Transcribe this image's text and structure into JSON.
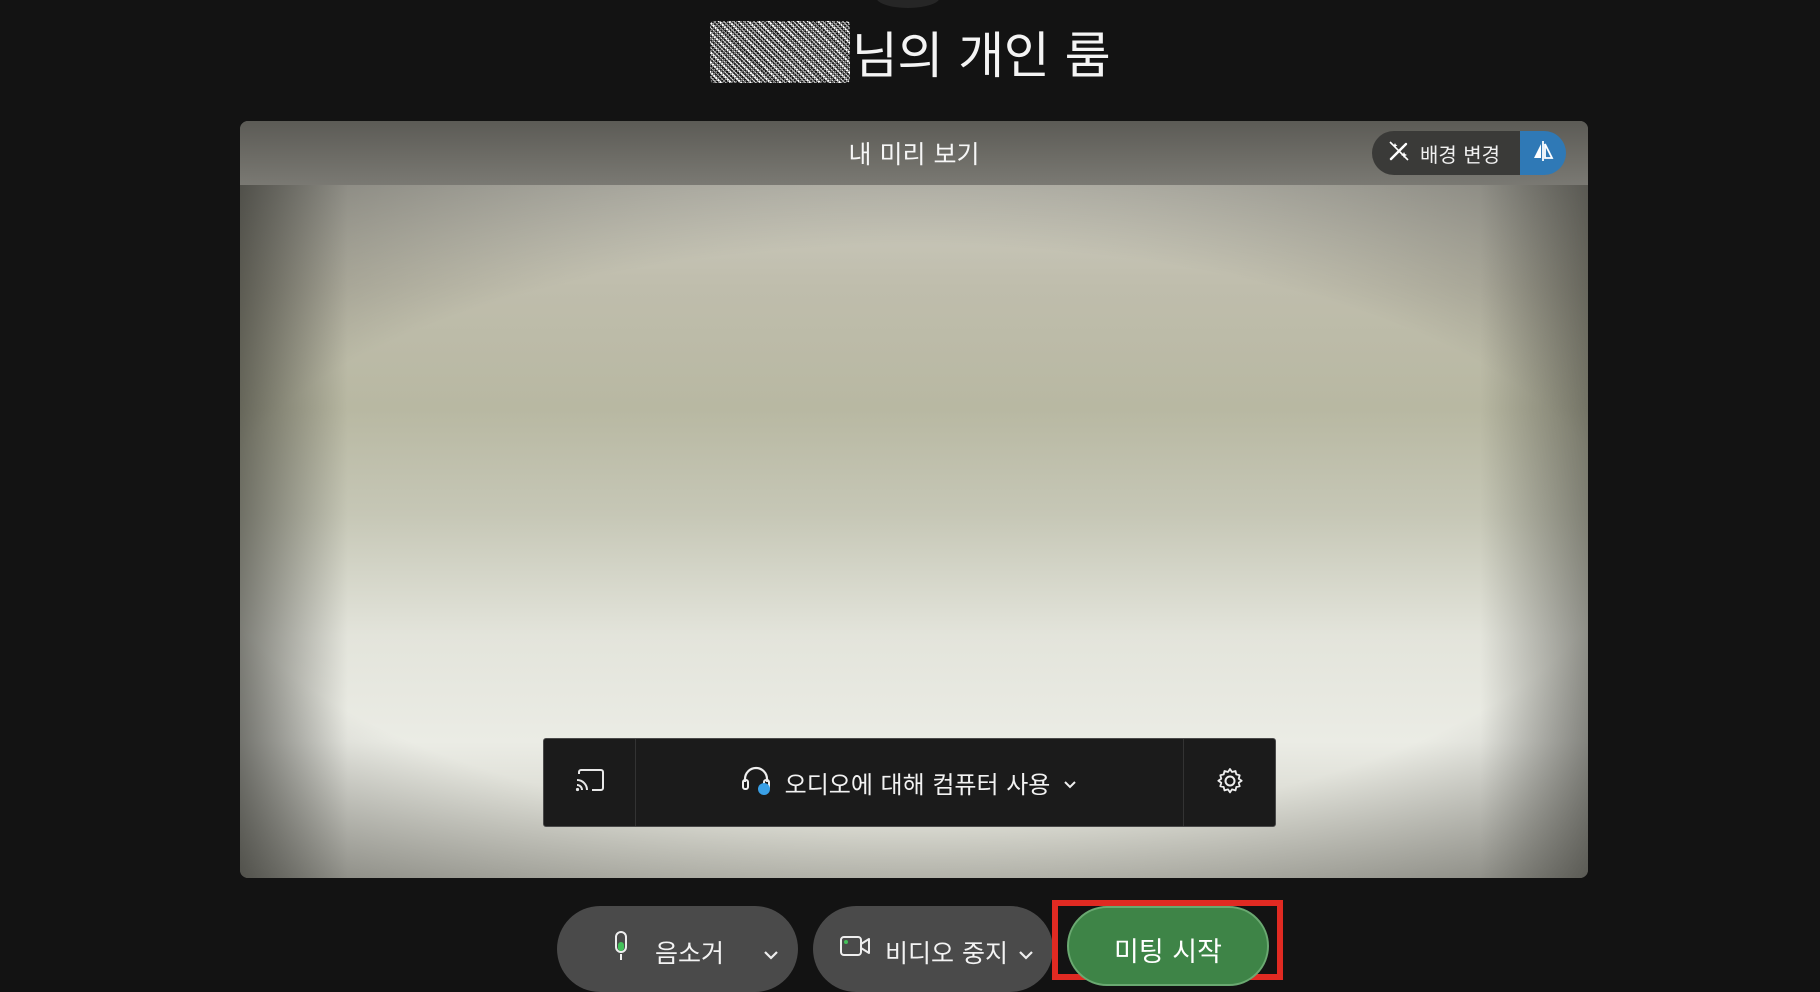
{
  "room": {
    "title_suffix": "님의 개인 룸"
  },
  "preview": {
    "label": "내 미리 보기",
    "change_background_label": "배경 변경"
  },
  "audio_bar": {
    "audio_option_label": "오디오에 대해 컴퓨터 사용"
  },
  "controls": {
    "mute_label": "음소거",
    "stop_video_label": "비디오 중지",
    "start_meeting_label": "미팅 시작"
  },
  "colors": {
    "background": "#131313",
    "start_button": "#3e8447",
    "highlight_outline": "#e02a22",
    "mirror_button": "#2f79b6",
    "mic_level": "#43c15a"
  },
  "icons": {
    "change_background": "magic-wand-icon",
    "mirror": "mirror-flip-icon",
    "cast": "cast-screen-icon",
    "audio_headset": "headset-icon",
    "settings": "gear-icon",
    "microphone": "microphone-icon",
    "video": "video-camera-icon",
    "chevron": "chevron-down-icon"
  }
}
